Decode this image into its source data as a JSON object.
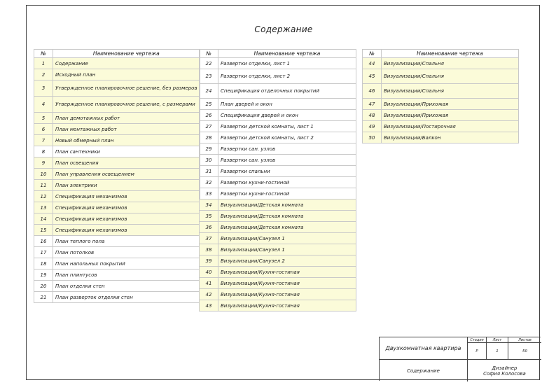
{
  "page_title": "Содержание",
  "table_header": {
    "num": "№",
    "name": "Наименование чертежа"
  },
  "columns": [
    [
      {
        "n": "1",
        "name": "Содержание",
        "hl": true
      },
      {
        "n": "2",
        "name": "Исходный план",
        "hl": true
      },
      {
        "n": "3",
        "name": "Утвержденное планировочное решение, без размеров",
        "hl": true,
        "tall": true
      },
      {
        "n": "4",
        "name": "Утвержденное планировочное решение, с размерами",
        "hl": true,
        "tall": true
      },
      {
        "n": "5",
        "name": "План демотажных работ",
        "hl": true
      },
      {
        "n": "6",
        "name": "План монтажных работ",
        "hl": true
      },
      {
        "n": "7",
        "name": "Новый обмерный план",
        "hl": true
      },
      {
        "n": "8",
        "name": "План сантехники",
        "hl": false
      },
      {
        "n": "9",
        "name": "План освещения",
        "hl": true
      },
      {
        "n": "10",
        "name": "План управления освещением",
        "hl": true
      },
      {
        "n": "11",
        "name": "План электрики",
        "hl": true
      },
      {
        "n": "12",
        "name": "Спецификация механизмов",
        "hl": true
      },
      {
        "n": "13",
        "name": "Спецификация механизмов",
        "hl": true
      },
      {
        "n": "14",
        "name": "Спецификация механизмов",
        "hl": true
      },
      {
        "n": "15",
        "name": "Спецификация механизмов",
        "hl": true
      },
      {
        "n": "16",
        "name": "План теплого пола",
        "hl": false
      },
      {
        "n": "17",
        "name": "План потолков",
        "hl": false
      },
      {
        "n": "18",
        "name": "План напольных покрытий",
        "hl": false
      },
      {
        "n": "19",
        "name": "План плинтусов",
        "hl": false
      },
      {
        "n": "20",
        "name": "План отделки стен",
        "hl": false
      },
      {
        "n": "21",
        "name": "План разверток отделки стен",
        "hl": false
      }
    ],
    [
      {
        "n": "22",
        "name": "Развертки отделки, лист 1",
        "hl": false
      },
      {
        "n": "23",
        "name": "Развертки отделки, лист 2",
        "hl": false,
        "tall2": true
      },
      {
        "n": "24",
        "name": "Спецификация отделочных покрытий",
        "hl": false,
        "tall2": true
      },
      {
        "n": "25",
        "name": "План дверей и окон",
        "hl": false
      },
      {
        "n": "26",
        "name": "Спецификация дверей и окон",
        "hl": false
      },
      {
        "n": "27",
        "name": "Развертки детской комнаты, лист 1",
        "hl": false
      },
      {
        "n": "28",
        "name": "Развертки детской комнаты, лист 2",
        "hl": false
      },
      {
        "n": "29",
        "name": "Развертки сан. узлов",
        "hl": false
      },
      {
        "n": "30",
        "name": "Развертки сан. узлов",
        "hl": false
      },
      {
        "n": "31",
        "name": "Развертки спальни",
        "hl": false
      },
      {
        "n": "32",
        "name": "Развертки кухни-гостиной",
        "hl": false
      },
      {
        "n": "33",
        "name": "Развертки кухни-гостиной",
        "hl": false
      },
      {
        "n": "34",
        "name": "Визуализации/Детская комната",
        "hl": true
      },
      {
        "n": "35",
        "name": "Визуализации/Детская комната",
        "hl": true
      },
      {
        "n": "36",
        "name": "Визуализации/Детская комната",
        "hl": true
      },
      {
        "n": "37",
        "name": "Визуализации/Санузел 1",
        "hl": true
      },
      {
        "n": "38",
        "name": "Визуализации/Санузел 1",
        "hl": true
      },
      {
        "n": "39",
        "name": "Визуализации/Санузел 2",
        "hl": true
      },
      {
        "n": "40",
        "name": "Визуализации/Кухня-гостиная",
        "hl": true
      },
      {
        "n": "41",
        "name": "Визуализации/Кухня-гостиная",
        "hl": true
      },
      {
        "n": "42",
        "name": "Визуализации/Кухня-гостиная",
        "hl": true
      },
      {
        "n": "43",
        "name": "Визуализации/Кухня-гостиная",
        "hl": true
      }
    ],
    [
      {
        "n": "44",
        "name": "Визуализации/Спальня",
        "hl": true
      },
      {
        "n": "45",
        "name": "Визуализации/Спальня",
        "hl": true,
        "tall2": true
      },
      {
        "n": "46",
        "name": "Визуализации/Спальня",
        "hl": true,
        "tall2": true
      },
      {
        "n": "47",
        "name": "Визуализации/Прихожая",
        "hl": true
      },
      {
        "n": "48",
        "name": "Визуализации/Прихожая",
        "hl": true
      },
      {
        "n": "49",
        "name": "Визуализации/Постирочная",
        "hl": true
      },
      {
        "n": "50",
        "name": "Визуализации/Балкон",
        "hl": true
      }
    ]
  ],
  "stamp": {
    "project": "Двухкомнатная квартира",
    "stage_label": "Стадия",
    "sheet_label": "Лист",
    "sheets_label": "Листов",
    "stage": "Р",
    "sheet": "1",
    "sheets": "50",
    "sheet_name": "Содержание",
    "role": "Дизайнер",
    "author": "София Колосова"
  },
  "colors": {
    "highlight": "#fbfbd9",
    "border": "#c9c9c9",
    "frame": "#444444"
  }
}
